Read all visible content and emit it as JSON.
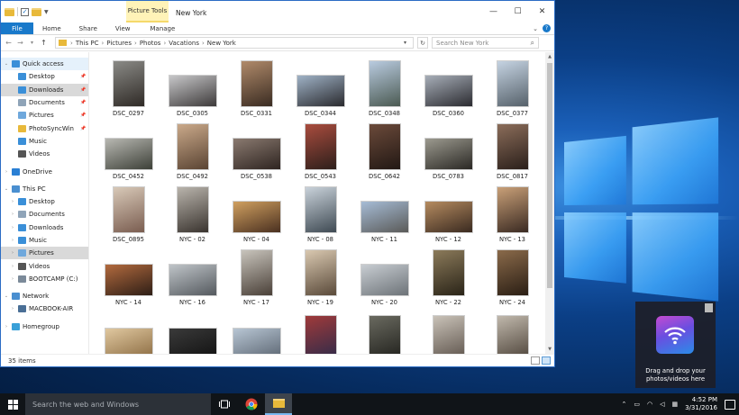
{
  "window": {
    "title": "New York",
    "picture_tools": "Picture Tools",
    "controls": {
      "minimize": "—",
      "maximize": "☐",
      "close": "✕"
    }
  },
  "ribbon": {
    "file": "File",
    "tabs": [
      "Home",
      "Share",
      "View",
      "Manage"
    ],
    "help": "?"
  },
  "address": {
    "crumbs": [
      "This PC",
      "Pictures",
      "Photos",
      "Vacations",
      "New York"
    ],
    "search_placeholder": "Search New York"
  },
  "nav": {
    "quick_access": "Quick access",
    "quick_items": [
      {
        "label": "Desktop",
        "color": "#3a8fd8",
        "pinned": true
      },
      {
        "label": "Downloads",
        "color": "#3a8fd8",
        "pinned": true
      },
      {
        "label": "Documents",
        "color": "#8fa4b8",
        "pinned": true
      },
      {
        "label": "Pictures",
        "color": "#6fa8dc",
        "pinned": true
      },
      {
        "label": "PhotoSyncWin",
        "color": "#e8b93a",
        "pinned": true
      },
      {
        "label": "Music",
        "color": "#3a8fd8",
        "pinned": false
      },
      {
        "label": "Videos",
        "color": "#555555",
        "pinned": false
      }
    ],
    "onedrive": "OneDrive",
    "this_pc": "This PC",
    "pc_items": [
      {
        "label": "Desktop",
        "color": "#3a8fd8"
      },
      {
        "label": "Documents",
        "color": "#8fa4b8"
      },
      {
        "label": "Downloads",
        "color": "#3a8fd8"
      },
      {
        "label": "Music",
        "color": "#3a8fd8"
      },
      {
        "label": "Pictures",
        "color": "#6fa8dc"
      },
      {
        "label": "Videos",
        "color": "#555555"
      },
      {
        "label": "BOOTCAMP (C:)",
        "color": "#7b8a99"
      }
    ],
    "network": "Network",
    "network_items": [
      {
        "label": "MACBOOK-AIR",
        "color": "#4a6f96"
      }
    ],
    "homegroup": "Homegroup"
  },
  "files": [
    {
      "name": "DSC_0297",
      "orient": "p",
      "tone": [
        "#8a8a86",
        "#2f2a26"
      ]
    },
    {
      "name": "DSC_0305",
      "orient": "l",
      "tone": [
        "#c7c7c9",
        "#3d3a3a"
      ]
    },
    {
      "name": "DSC_0331",
      "orient": "p",
      "tone": [
        "#b08a6a",
        "#3a2c22"
      ]
    },
    {
      "name": "DSC_0344",
      "orient": "l",
      "tone": [
        "#9fb2c6",
        "#2a2a2e"
      ]
    },
    {
      "name": "DSC_0348",
      "orient": "p",
      "tone": [
        "#b9cbe0",
        "#4b5a52"
      ]
    },
    {
      "name": "DSC_0360",
      "orient": "l",
      "tone": [
        "#a7aeb8",
        "#2b2b30"
      ]
    },
    {
      "name": "DSC_0377",
      "orient": "p",
      "tone": [
        "#c5d3e2",
        "#56616a"
      ]
    },
    {
      "name": "DSC_0452",
      "orient": "l",
      "tone": [
        "#b8b8b2",
        "#3d4038"
      ]
    },
    {
      "name": "DSC_0492",
      "orient": "p",
      "tone": [
        "#caa98a",
        "#5a4433"
      ]
    },
    {
      "name": "DSC_0538",
      "orient": "l",
      "tone": [
        "#8a7a70",
        "#2e2420"
      ]
    },
    {
      "name": "DSC_0543",
      "orient": "p",
      "tone": [
        "#a94c3e",
        "#2d1f1b"
      ]
    },
    {
      "name": "DSC_0642",
      "orient": "p",
      "tone": [
        "#6b4a3a",
        "#221814"
      ]
    },
    {
      "name": "DSC_0783",
      "orient": "l",
      "tone": [
        "#9c9a8f",
        "#2a2824"
      ]
    },
    {
      "name": "DSC_0817",
      "orient": "p",
      "tone": [
        "#8b6d5a",
        "#2a1f1a"
      ]
    },
    {
      "name": "DSC_0895",
      "orient": "p",
      "tone": [
        "#d8c9b8",
        "#7a5d50"
      ]
    },
    {
      "name": "NYC - 02",
      "orient": "p",
      "tone": [
        "#b9b4ac",
        "#3a342f"
      ]
    },
    {
      "name": "NYC - 04",
      "orient": "l",
      "tone": [
        "#d0a060",
        "#4a3020"
      ]
    },
    {
      "name": "NYC - 08",
      "orient": "p",
      "tone": [
        "#c9d2da",
        "#3f4a53"
      ]
    },
    {
      "name": "NYC - 11",
      "orient": "l",
      "tone": [
        "#a6bcd6",
        "#5a5a58"
      ]
    },
    {
      "name": "NYC - 12",
      "orient": "l",
      "tone": [
        "#b58b60",
        "#3a2a20"
      ]
    },
    {
      "name": "NYC - 13",
      "orient": "p",
      "tone": [
        "#c9a078",
        "#3a2a22"
      ]
    },
    {
      "name": "NYC - 14",
      "orient": "l",
      "tone": [
        "#b26a3e",
        "#2e1e16"
      ]
    },
    {
      "name": "NYC - 16",
      "orient": "l",
      "tone": [
        "#bfc4c8",
        "#54595e"
      ]
    },
    {
      "name": "NYC - 17",
      "orient": "p",
      "tone": [
        "#c8c4bc",
        "#4a4038"
      ]
    },
    {
      "name": "NYC - 19",
      "orient": "p",
      "tone": [
        "#d9c8b0",
        "#5a4a3a"
      ]
    },
    {
      "name": "NYC - 20",
      "orient": "l",
      "tone": [
        "#c8cdd2",
        "#6d7378"
      ]
    },
    {
      "name": "NYC - 22",
      "orient": "p",
      "tone": [
        "#8b7a5a",
        "#2a2418"
      ]
    },
    {
      "name": "NYC - 24",
      "orient": "p",
      "tone": [
        "#8a6a4a",
        "#2a1e14"
      ]
    },
    {
      "name": "",
      "orient": "l",
      "tone": [
        "#e0c8a0",
        "#8a6a40"
      ]
    },
    {
      "name": "",
      "orient": "l",
      "tone": [
        "#3a3a3a",
        "#111111"
      ]
    },
    {
      "name": "",
      "orient": "l",
      "tone": [
        "#b8c6d4",
        "#5a6470"
      ]
    },
    {
      "name": "",
      "orient": "p",
      "tone": [
        "#a03a3a",
        "#2a2a4a"
      ]
    },
    {
      "name": "",
      "orient": "p",
      "tone": [
        "#6a6a60",
        "#1e1e1a"
      ]
    },
    {
      "name": "",
      "orient": "p",
      "tone": [
        "#c9c2b8",
        "#5a5048"
      ]
    },
    {
      "name": "",
      "orient": "p",
      "tone": [
        "#c0b8ac",
        "#4a4036"
      ]
    }
  ],
  "status": {
    "count": "35 items"
  },
  "toast": {
    "message": "Drag and drop your photos/videos here"
  },
  "taskbar": {
    "search_placeholder": "Search the web and Windows",
    "time": "4:52 PM",
    "date": "3/31/2016"
  }
}
